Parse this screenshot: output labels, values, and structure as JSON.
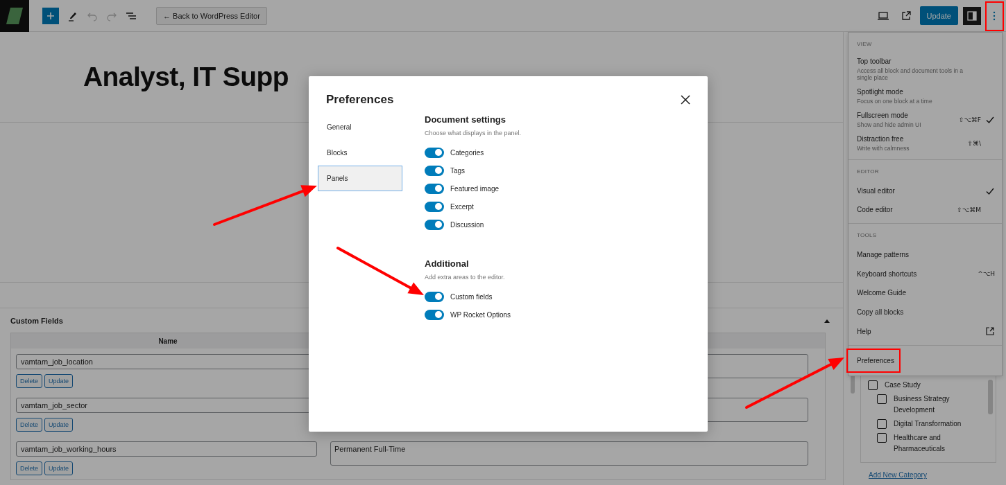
{
  "toolbar": {
    "back_button": "← Back to WordPress Editor",
    "update_button": "Update"
  },
  "post_title": "Analyst, IT Supp",
  "custom_fields": {
    "title": "Custom Fields",
    "columns": [
      "Name"
    ],
    "rows": [
      {
        "name": "vamtam_job_location",
        "buttons": [
          "Delete",
          "Update"
        ]
      },
      {
        "name": "vamtam_job_sector",
        "buttons": [
          "Delete",
          "Update"
        ]
      },
      {
        "name": "vamtam_job_working_hours",
        "value": "Permanent Full-Time",
        "buttons": [
          "Delete",
          "Update"
        ]
      }
    ]
  },
  "categories": [
    {
      "label": "Case Study",
      "checked": false,
      "children": [
        {
          "label": "Business Strategy Development",
          "checked": false
        },
        {
          "label": "Digital Transformation",
          "checked": false
        },
        {
          "label": "Healthcare and Pharmaceuticals",
          "checked": false
        }
      ]
    }
  ],
  "add_category_link": "Add New Category",
  "menu": {
    "sections": [
      {
        "heading": "VIEW",
        "items": [
          {
            "label": "Top toolbar",
            "description": "Access all block and document tools in a single place",
            "checked": false
          },
          {
            "label": "Spotlight mode",
            "description": "Focus on one block at a time",
            "checked": false
          },
          {
            "label": "Fullscreen mode",
            "description": "Show and hide admin UI",
            "shortcut": "⇧⌥⌘F",
            "checked": true
          },
          {
            "label": "Distraction free",
            "description": "Write with calmness",
            "shortcut": "⇧⌘\\",
            "checked": false
          }
        ]
      },
      {
        "heading": "EDITOR",
        "items": [
          {
            "label": "Visual editor",
            "checked": true
          },
          {
            "label": "Code editor",
            "shortcut": "⇧⌥⌘M",
            "checked": false
          }
        ]
      },
      {
        "heading": "TOOLS",
        "items": [
          {
            "label": "Manage patterns",
            "kind": "action"
          },
          {
            "label": "Keyboard shortcuts",
            "shortcut": "^⌥H",
            "kind": "action"
          },
          {
            "label": "Welcome Guide",
            "kind": "action"
          },
          {
            "label": "Copy all blocks",
            "kind": "action"
          },
          {
            "label": "Help",
            "kind": "external"
          }
        ]
      }
    ],
    "preferences": "Preferences"
  },
  "modal": {
    "title": "Preferences",
    "tabs": [
      {
        "label": "General",
        "selected": false
      },
      {
        "label": "Blocks",
        "selected": false
      },
      {
        "label": "Panels",
        "selected": true
      }
    ],
    "sections": [
      {
        "heading": "Document settings",
        "description": "Choose what displays in the panel.",
        "options": [
          {
            "label": "Categories",
            "on": true
          },
          {
            "label": "Tags",
            "on": true
          },
          {
            "label": "Featured image",
            "on": true
          },
          {
            "label": "Excerpt",
            "on": true
          },
          {
            "label": "Discussion",
            "on": true
          }
        ]
      },
      {
        "heading": "Additional",
        "description": "Add extra areas to the editor.",
        "options": [
          {
            "label": "Custom fields",
            "on": true
          },
          {
            "label": "WP Rocket Options",
            "on": true
          }
        ]
      }
    ]
  }
}
